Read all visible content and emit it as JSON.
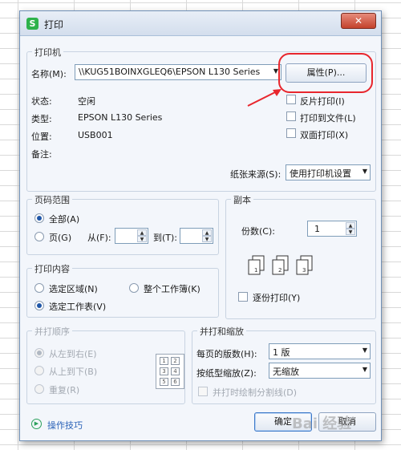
{
  "window": {
    "title": "打印",
    "close_glyph": "✕"
  },
  "printer": {
    "group_title": "打印机",
    "name_label": "名称(M):",
    "name_value": "\\\\KUG51BOINXGLEQ6\\EPSON L130 Series",
    "properties_button": "属性(P)...",
    "status_label": "状态:",
    "status_value": "空闲",
    "type_label": "类型:",
    "type_value": "EPSON L130 Series",
    "location_label": "位置:",
    "location_value": "USB001",
    "comment_label": "备注:",
    "comment_value": "",
    "reverse_print": "反片打印(I)",
    "print_to_file": "打印到文件(L)",
    "duplex_print": "双面打印(X)",
    "paper_source_label": "纸张来源(S):",
    "paper_source_value": "使用打印机设置"
  },
  "page_range": {
    "group_title": "页码范围",
    "all_label": "全部(A)",
    "pages_label": "页(G)",
    "from_label": "从(F):",
    "from_value": "",
    "to_label": "到(T):",
    "to_value": ""
  },
  "copies": {
    "group_title": "副本",
    "count_label": "份数(C):",
    "count_value": "1",
    "collate_label": "逐份打印(Y)"
  },
  "print_content": {
    "group_title": "打印内容",
    "selection_label": "选定区域(N)",
    "workbook_label": "整个工作簿(K)",
    "sheet_label": "选定工作表(V)"
  },
  "collate_order": {
    "group_title": "并打顺序",
    "left_to_right": "从左到右(E)",
    "top_to_bottom": "从上到下(B)",
    "repeat": "重复(R)",
    "grid_cells": [
      "1",
      "2",
      "3",
      "4",
      "5",
      "6"
    ]
  },
  "scaling": {
    "group_title": "并打和缩放",
    "pages_per_sheet_label": "每页的版数(H):",
    "pages_per_sheet_value": "1 版",
    "scale_paper_label": "按纸型缩放(Z):",
    "scale_paper_value": "无缩放",
    "draw_borders_label": "并打时绘制分割线(D)"
  },
  "footer": {
    "tips_link": "操作技巧",
    "ok_button": "确定",
    "cancel_button": "取消"
  },
  "colors": {
    "accent_blue": "#3b78c9",
    "annotation_red": "#e8262d",
    "app_icon_green": "#2eb24b"
  }
}
